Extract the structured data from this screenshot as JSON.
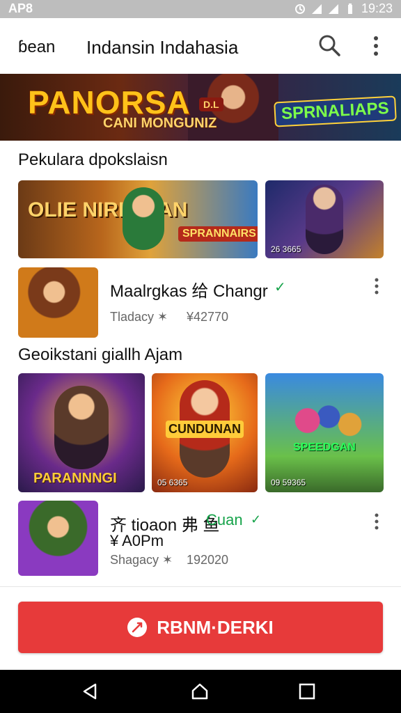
{
  "status_bar": {
    "carrier": "AP8",
    "time": "19:23"
  },
  "app_bar": {
    "back_label": "ɓean",
    "title": "Indansin Indahasia"
  },
  "banner": {
    "title": "PANORSA",
    "subtitle": "CANI MONGUNIZ",
    "right_badge": "SPRNALIAPS",
    "small_badge": "D.L"
  },
  "section1": {
    "title": "Pekulara dpokslaisn",
    "tiles": [
      {
        "label": ""
      },
      {
        "label": "26 3665"
      }
    ],
    "list_item": {
      "title": "Maalrgkas 给 Changr",
      "meta_left": "Tladacy ✶",
      "meta_right": "¥42770"
    }
  },
  "section2": {
    "title": "Geoikstani giallh Ajam",
    "tiles": [
      {
        "label": "PARANNNGI"
      },
      {
        "label": "05 6365"
      },
      {
        "label": "09 59365"
      }
    ],
    "list_item": {
      "title": "齐 tioaon 弗 鱼",
      "title_green": "Cuan",
      "price": "¥ A0Pm",
      "meta_left": "Shagacy ✶",
      "meta_right": "192020"
    }
  },
  "button": {
    "label": "RBNM·DERKI"
  },
  "colors": {
    "accent": "#e73a3a",
    "green": "#16a34a"
  }
}
